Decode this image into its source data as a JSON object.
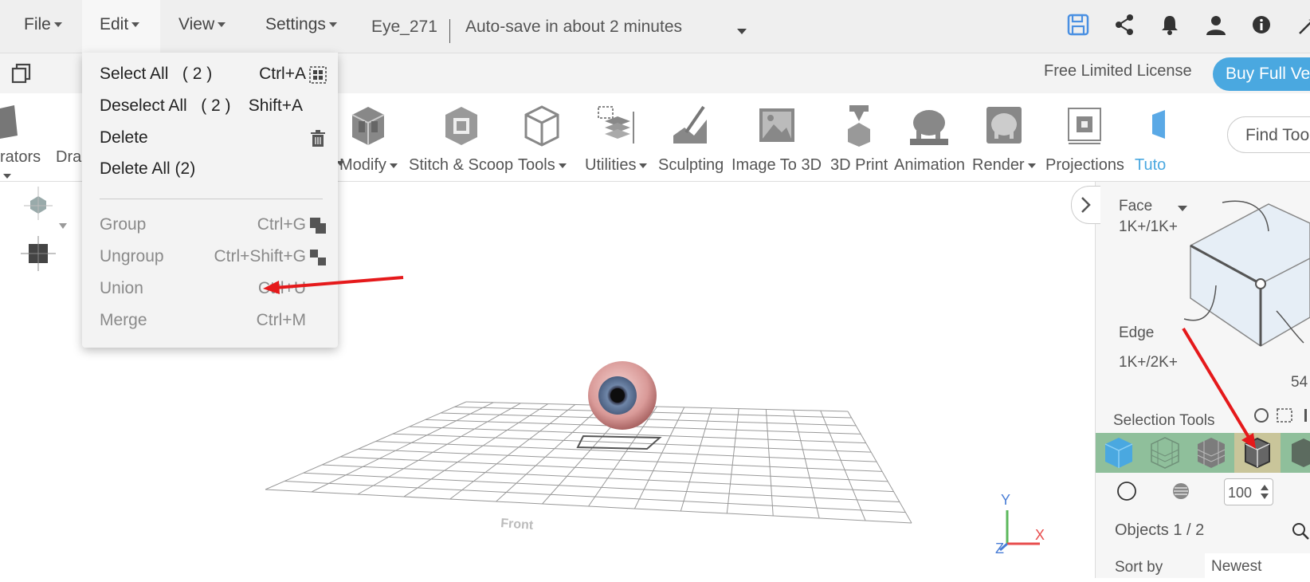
{
  "menubar": {
    "file": "File",
    "edit": "Edit",
    "view": "View",
    "settings": "Settings",
    "doc_name": "Eye_271",
    "autosave": "Auto-save in about 2 minutes"
  },
  "license": {
    "text": "Free Limited License",
    "buy": "Buy Full Ve"
  },
  "toolbar": {
    "partial_left1": "rators",
    "partial_left2": "Dra",
    "modify": "Modify",
    "stitch": "Stitch & Scoop",
    "tools": "Tools",
    "utilities": "Utilities",
    "sculpting": "Sculpting",
    "image_to_3d": "Image To 3D",
    "print_3d": "3D Print",
    "animation": "Animation",
    "render": "Render",
    "projections": "Projections",
    "tuto": "Tuto",
    "find_tools": "Find Too"
  },
  "edit_menu": {
    "items": [
      {
        "label": "Select All   ( 2 )",
        "shortcut": "Ctrl+A"
      },
      {
        "label": "Deselect All   ( 2 )",
        "shortcut": "Shift+A"
      },
      {
        "label": "Delete",
        "shortcut": ""
      },
      {
        "label": "Delete All (2)",
        "shortcut": ""
      },
      {
        "label": "Group",
        "shortcut": "Ctrl+G"
      },
      {
        "label": "Ungroup",
        "shortcut": "Ctrl+Shift+G"
      },
      {
        "label": "Union",
        "shortcut": "Ctrl+U"
      },
      {
        "label": "Merge",
        "shortcut": "Ctrl+M"
      }
    ]
  },
  "right_panel": {
    "face_label": "Face",
    "face_count": "1K+/1K+",
    "edge_label": "Edge",
    "edge_count": "1K+/2K+",
    "vertex_count_partial": "54",
    "selection_tools": "Selection Tools",
    "number_value": "100",
    "objects": "Objects 1 / 2",
    "sort_by": "Sort by",
    "sort_value": "Newest"
  },
  "viewport": {
    "front_label": "Front",
    "axis_x": "X",
    "axis_y": "Y",
    "axis_z": "Z"
  },
  "colors": {
    "accent_blue": "#4aa8e0",
    "annotation_red": "#e5191b",
    "selection_strip": "#8fbf9b"
  }
}
